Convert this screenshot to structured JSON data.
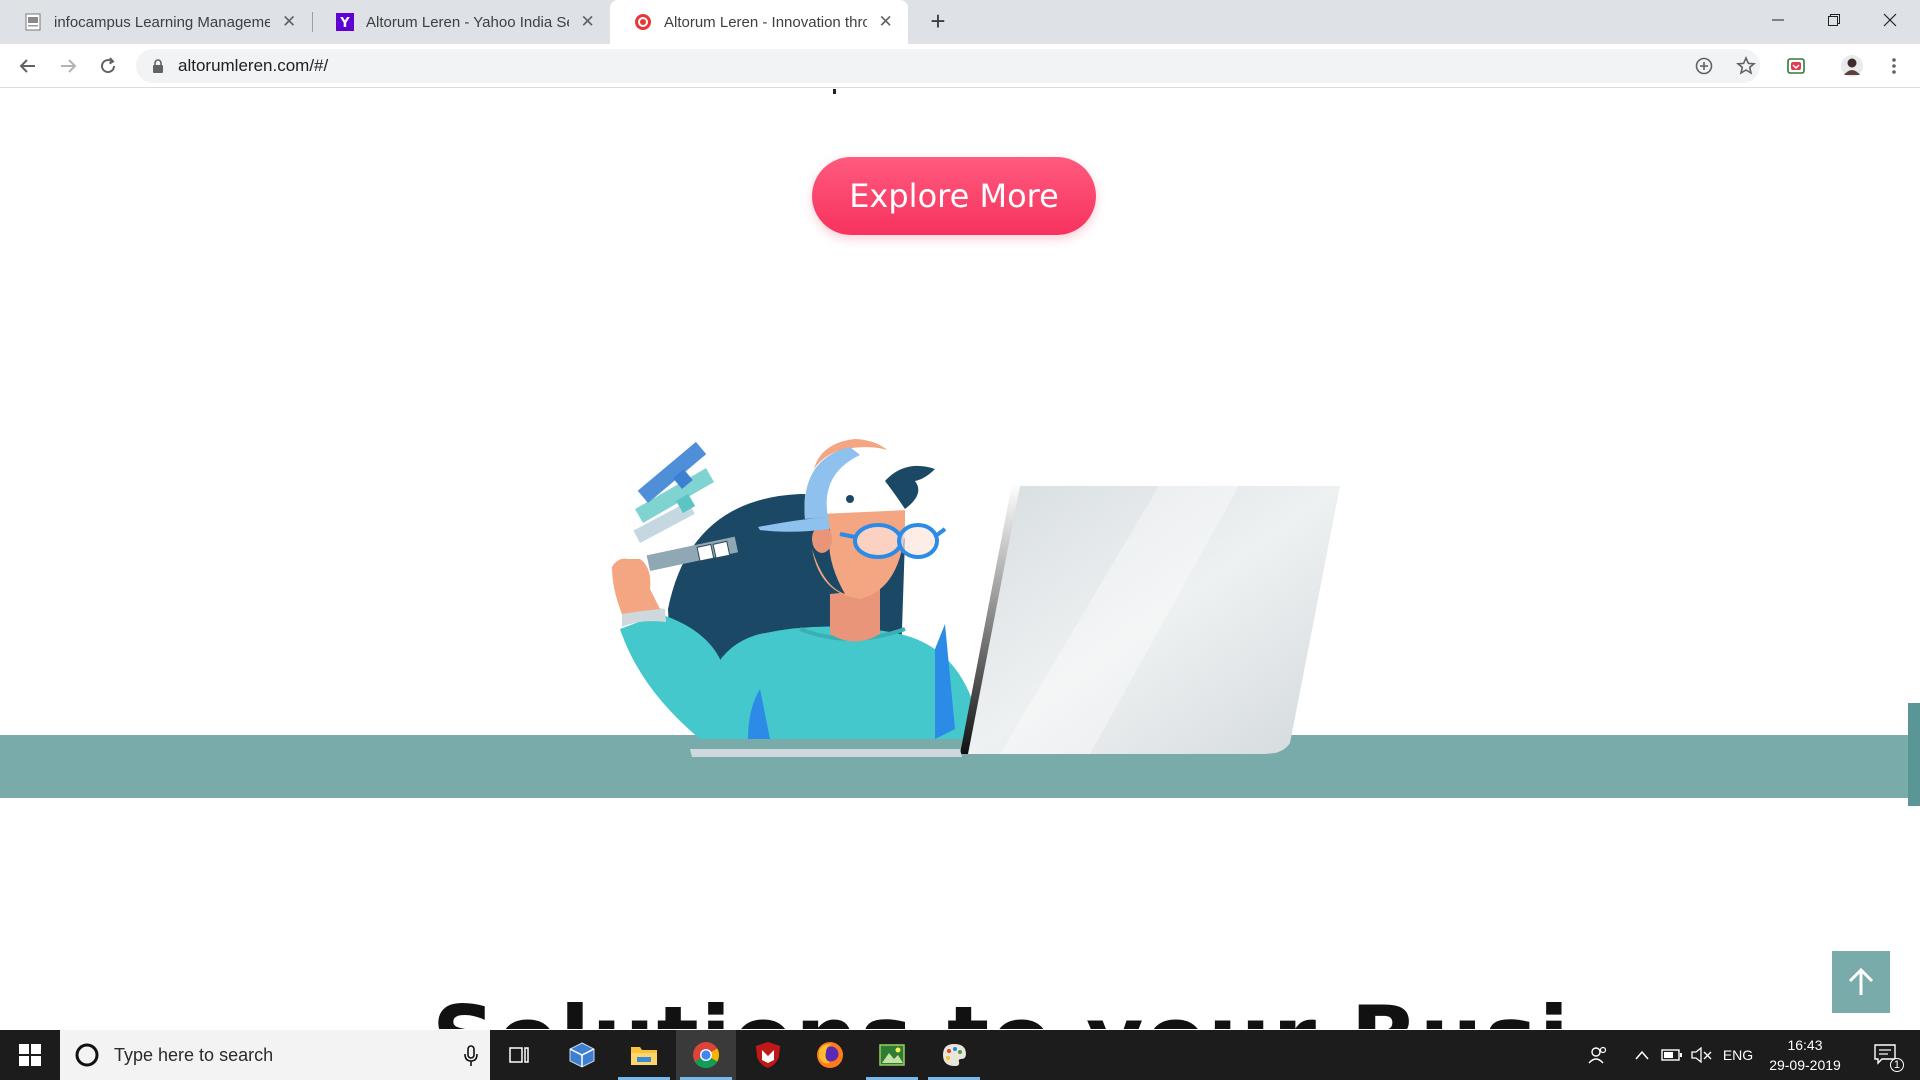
{
  "browser": {
    "tabs": [
      {
        "title": "infocampus Learning Manageme",
        "active": false
      },
      {
        "title": "Altorum Leren - Yahoo India Sear",
        "active": false
      },
      {
        "title": "Altorum Leren - Innovation throu",
        "active": true
      }
    ],
    "address_bar": {
      "url": "altorumleren.com/#/"
    }
  },
  "page": {
    "explore_button": "Explore More",
    "partial_heading": "Solutions to your Busi",
    "colors": {
      "accent_pink": "#f7325e",
      "band_teal": "#79abab",
      "shirt_teal": "#45c8cc"
    }
  },
  "taskbar": {
    "search_placeholder": "Type here to search",
    "tray": {
      "language": "ENG",
      "notification_count": "1"
    },
    "clock": {
      "time": "16:43",
      "date": "29-09-2019"
    }
  }
}
